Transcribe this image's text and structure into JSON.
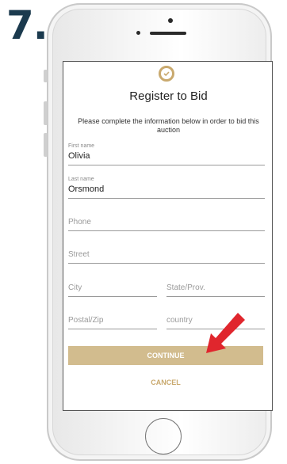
{
  "step_label": "7.",
  "form": {
    "title": "Register to Bid",
    "description": "Please complete the information below in order to bid this auction",
    "first_name": {
      "label": "First name",
      "value": "Olivia"
    },
    "last_name": {
      "label": "Last name",
      "value": "Orsmond"
    },
    "phone": {
      "placeholder": "Phone"
    },
    "street": {
      "placeholder": "Street"
    },
    "city": {
      "placeholder": "City"
    },
    "state": {
      "placeholder": "State/Prov."
    },
    "postal": {
      "placeholder": "Postal/Zip"
    },
    "country": {
      "placeholder": "country"
    },
    "continue_label": "CONTINUE",
    "cancel_label": "CANCEL"
  },
  "colors": {
    "accent": "#c9a96e",
    "button": "#d2bc8e",
    "step_number": "#1b3a4e",
    "arrow": "#e0262d"
  },
  "icons": {
    "badge": "check-badge-icon",
    "arrow": "red-arrow-icon"
  }
}
